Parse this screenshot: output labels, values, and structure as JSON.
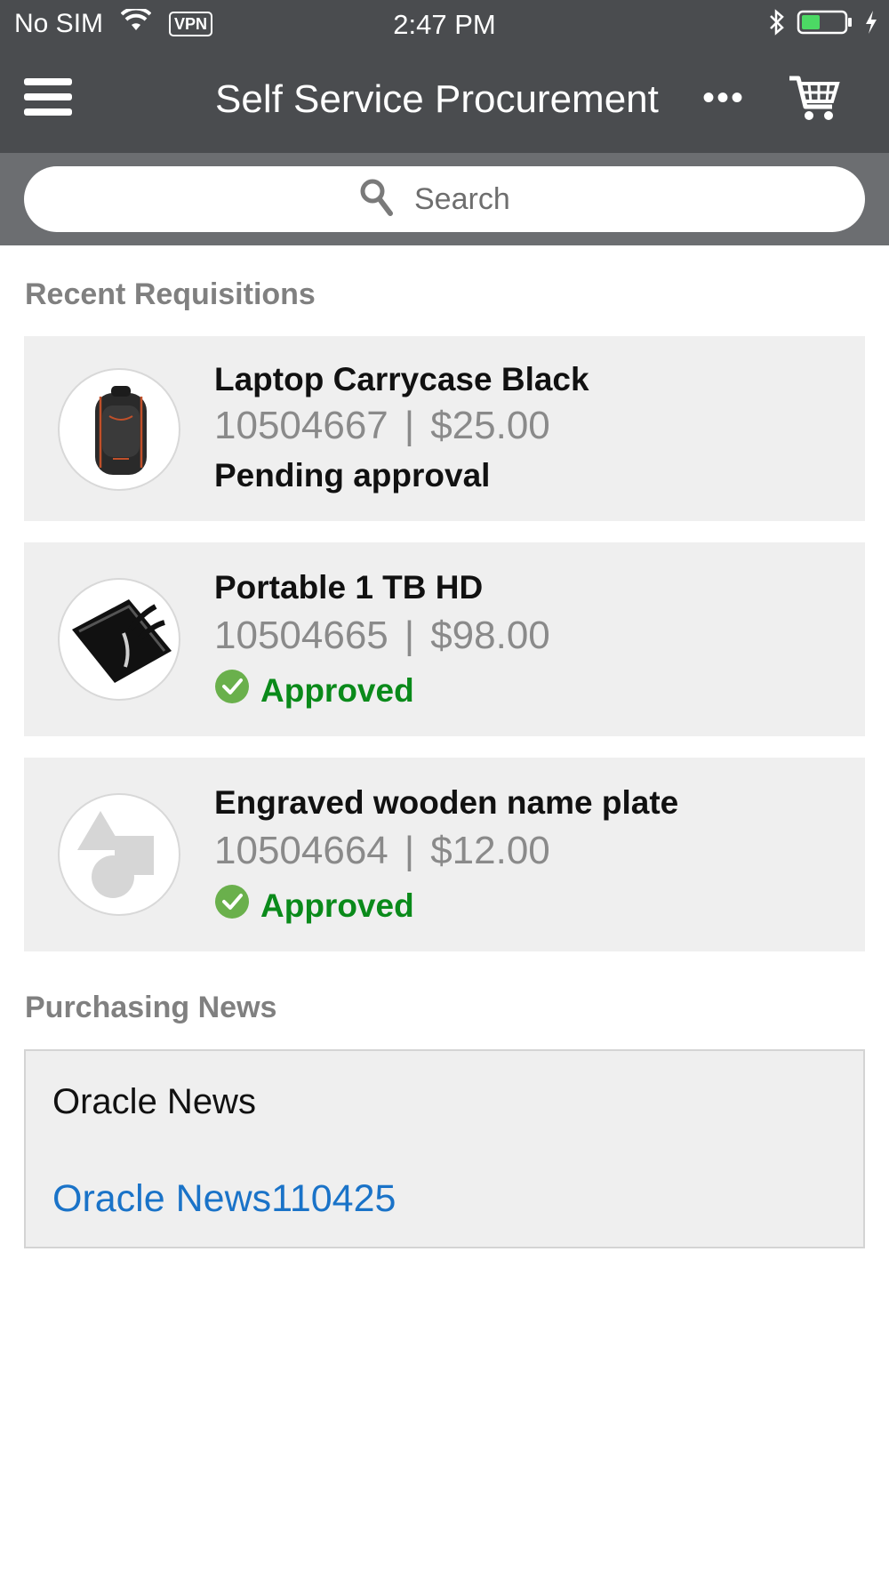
{
  "statusbar": {
    "carrier": "No SIM",
    "vpn": "VPN",
    "time": "2:47 PM"
  },
  "navbar": {
    "title": "Self Service Procurement",
    "more": "•••"
  },
  "search": {
    "placeholder": "Search"
  },
  "recent": {
    "title": "Recent Requisitions",
    "items": [
      {
        "name": "Laptop Carrycase Black",
        "number": "10504667",
        "separator": "|",
        "amount": "$25.00",
        "status": "Pending approval",
        "image": "backpack"
      },
      {
        "name": "Portable 1 TB HD",
        "number": "10504665",
        "separator": "|",
        "amount": "$98.00",
        "status": "Approved",
        "image": "hard-drive"
      },
      {
        "name": "Engraved wooden name plate",
        "number": "10504664",
        "separator": "|",
        "amount": "$12.00",
        "status": "Approved",
        "image": "placeholder-shapes"
      }
    ]
  },
  "news": {
    "title": "Purchasing News",
    "box_title": "Oracle News",
    "link": "Oracle News110425"
  },
  "colors": {
    "header_bg": "#4a4c4f",
    "search_bg": "#6c6e71",
    "approved": "#0a8a1a",
    "approved_icon": "#6ab04c",
    "link": "#1a73c8",
    "battery": "#4cd964"
  }
}
